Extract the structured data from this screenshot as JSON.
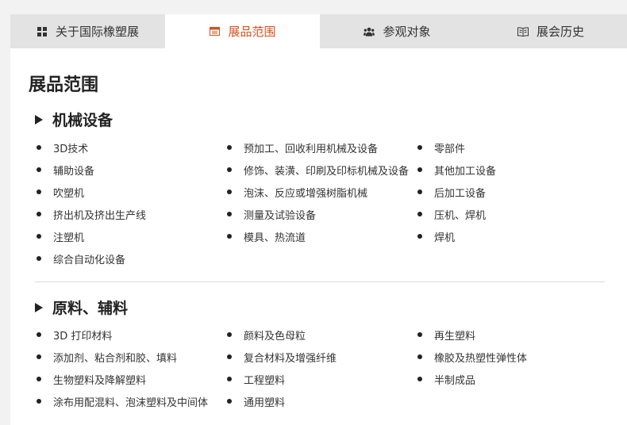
{
  "tabs": [
    {
      "label": "关于国际橡塑展",
      "icon": "grid-icon"
    },
    {
      "label": "展品范围",
      "icon": "calendar-icon"
    },
    {
      "label": "参观对象",
      "icon": "users-icon"
    },
    {
      "label": "展会历史",
      "icon": "book-icon"
    }
  ],
  "colors": {
    "accent": "#d8501e",
    "tab_bg": "#e3e3e3",
    "active_tab_bg": "#ffffff"
  },
  "page_title": "展品范围",
  "sections": [
    {
      "title": "机械设备",
      "items": [
        "3D技术",
        "预加工、回收利用机械及设备",
        "零部件",
        "辅助设备",
        "修饰、装潢、印刷及印标机械及设备",
        "其他加工设备",
        "吹塑机",
        "泡沫、反应或增强树脂机械",
        "后加工设备",
        "挤出机及挤出生产线",
        "测量及试验设备",
        "压机、焊机",
        "注塑机",
        "模具、热流道",
        "焊机",
        "综合自动化设备"
      ]
    },
    {
      "title": "原料、辅料",
      "items": [
        "3D 打印材料",
        "颜料及色母粒",
        "再生塑料",
        "添加剂、粘合剂和胶、填料",
        "复合材料及增强纤维",
        "橡胶及热塑性弹性体",
        "生物塑料及降解塑料",
        "工程塑料",
        "半制成品",
        "涂布用配混料、泡沫塑料及中间体",
        "通用塑料"
      ]
    }
  ]
}
